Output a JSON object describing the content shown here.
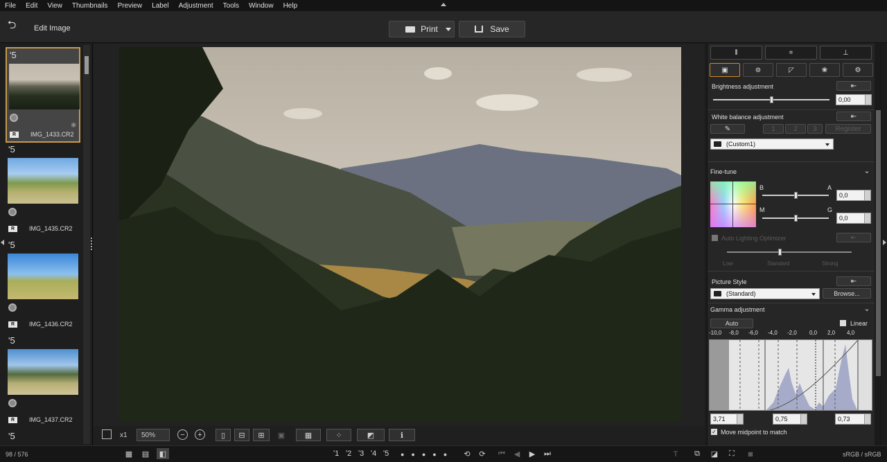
{
  "menu": [
    "File",
    "Edit",
    "View",
    "Thumbnails",
    "Preview",
    "Label",
    "Adjustment",
    "Tools",
    "Window",
    "Help"
  ],
  "toolbar": {
    "title": "Edit Image",
    "print_label": "Print",
    "save_label": "Save"
  },
  "thumbnails": [
    {
      "rating": "ʹ5",
      "filename": "IMG_1433.CR2",
      "raw": "R",
      "selected": true
    },
    {
      "rating": "ʹ5",
      "filename": "IMG_1435.CR2",
      "raw": "R"
    },
    {
      "rating": "ʹ5",
      "filename": "IMG_1436.CR2",
      "raw": "R"
    },
    {
      "rating": "ʹ5",
      "filename": "IMG_1437.CR2",
      "raw": "R"
    },
    {
      "rating": "ʹ5"
    }
  ],
  "viewer_bar": {
    "zoom_prefix": "x1",
    "zoom_value": "50%"
  },
  "status": {
    "count": "98 / 576",
    "ratings": [
      "ʹ1",
      "ʹ2",
      "ʹ3",
      "ʹ4",
      "ʹ5"
    ],
    "color_space": "sRGB / sRGB"
  },
  "panel": {
    "brightness": {
      "label": "Brightness adjustment",
      "value": "0,00",
      "level": 0.5
    },
    "white_balance": {
      "label": "White balance adjustment",
      "preset": "(Custom1)",
      "slots": [
        "1",
        "2",
        "3"
      ],
      "register": "Register"
    },
    "fine_tune": {
      "label": "Fine-tune",
      "b": "B",
      "a": "A",
      "m": "M",
      "g": "G",
      "ba_value": "0,0",
      "mg_value": "0,0"
    },
    "auto_lighting": {
      "label": "Auto Lighting Optimizer",
      "levels": [
        "Low",
        "Standard",
        "Strong"
      ]
    },
    "picture_style": {
      "label": "Picture Style",
      "value": "(Standard)",
      "browse": "Browse..."
    },
    "gamma": {
      "label": "Gamma adjustment",
      "auto": "Auto",
      "linear": "Linear",
      "axis": [
        "-10,0",
        "-8,0",
        "-6,0",
        "-4,0",
        "-2,0",
        "0,0",
        "2,0",
        "4,0"
      ],
      "v1": "3,71",
      "v2": "0,75",
      "v3": "0,73",
      "midpoint": "Move midpoint to match"
    }
  }
}
